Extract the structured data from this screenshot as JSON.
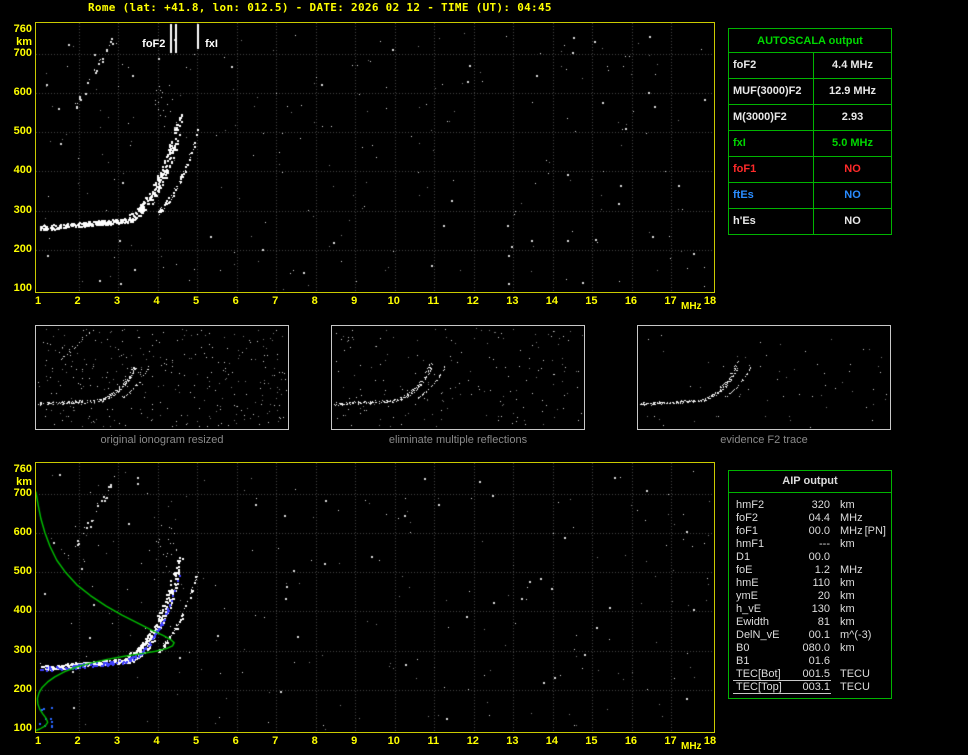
{
  "header": {
    "title": "Rome (lat: +41.8, lon: 012.5) - DATE: 2026 02 12 - TIME (UT): 04:45"
  },
  "colors": {
    "accent_yellow": "#ffff00",
    "plot_border": "#caca00",
    "grid": "#454545",
    "table_green": "#00b400",
    "title_green": "#00d800",
    "profile_green": "#00c000",
    "trace_blue": "#3f3fff",
    "no_red": "#ff2a2a",
    "no_blue": "#2a8cff",
    "text_light": "#e8e8e8",
    "caption_gray": "#8a8a8a"
  },
  "axes": {
    "x_ticks": [
      1,
      2,
      3,
      4,
      5,
      6,
      7,
      8,
      9,
      10,
      11,
      12,
      13,
      14,
      15,
      16,
      17,
      18
    ],
    "x_unit": "MHz",
    "y_ticks": [
      760,
      700,
      600,
      500,
      400,
      300,
      200,
      100
    ],
    "y_unit": "km"
  },
  "top_plot": {
    "markers": [
      {
        "label": "foF2",
        "freq": 4.4
      },
      {
        "label": "fxI",
        "freq": 5.0
      }
    ]
  },
  "autoscala": {
    "title": "AUTOSCALA output",
    "rows": [
      {
        "param": "foF2",
        "value": "4.4 MHz",
        "color": "#e8e8e8"
      },
      {
        "param": "MUF(3000)F2",
        "value": "12.9 MHz",
        "color": "#e8e8e8"
      },
      {
        "param": "M(3000)F2",
        "value": "2.93",
        "color": "#e8e8e8"
      },
      {
        "param": "fxI",
        "value": "5.0 MHz",
        "color": "#00d800"
      },
      {
        "param": "foF1",
        "value": "NO",
        "color": "#ff2a2a"
      },
      {
        "param": "ftEs",
        "value": "NO",
        "color": "#2a8cff"
      },
      {
        "param": "h'Es",
        "value": "NO",
        "color": "#e8e8e8"
      }
    ]
  },
  "thumbnails": [
    {
      "caption": "original ionogram resized"
    },
    {
      "caption": "eliminate multiple reflections"
    },
    {
      "caption": "evidence F2 trace"
    }
  ],
  "aip": {
    "title": "AIP output",
    "rows": [
      {
        "param": "hmF2",
        "value": "320",
        "unit": "km"
      },
      {
        "param": "foF2",
        "value": "04.4",
        "unit": "MHz"
      },
      {
        "param": "foF1",
        "value": "00.0",
        "unit": "MHz",
        "extra": "[PN]"
      },
      {
        "param": "hmF1",
        "value": "---",
        "unit": "km"
      },
      {
        "param": "D1",
        "value": "00.0",
        "unit": ""
      },
      {
        "param": "foE",
        "value": "1.2",
        "unit": "MHz"
      },
      {
        "param": "hmE",
        "value": "110",
        "unit": "km"
      },
      {
        "param": "ymE",
        "value": "20",
        "unit": "km"
      },
      {
        "param": "h_vE",
        "value": "130",
        "unit": "km"
      },
      {
        "param": "Ewidth",
        "value": "81",
        "unit": "km"
      },
      {
        "param": "DelN_vE",
        "value": "00.1",
        "unit": "m^(-3)"
      },
      {
        "param": "B0",
        "value": "080.0",
        "unit": "km"
      },
      {
        "param": "B1",
        "value": "01.6",
        "unit": ""
      },
      {
        "param": "TEC[Bot]",
        "value": "001.5",
        "unit": "TECU",
        "underline": true
      },
      {
        "param": "TEC[Top]",
        "value": "003.1",
        "unit": "TECU",
        "underline": true
      }
    ]
  },
  "chart_data": {
    "type": "scatter",
    "title": "Vertical-incidence ionogram, Rome, 2026-02-12 04:45 UT",
    "xlabel": "MHz",
    "ylabel": "km",
    "xlim": [
      1,
      18
    ],
    "ylim": [
      100,
      760
    ],
    "grid": true,
    "scaled_values": {
      "foF2_MHz": 4.4,
      "MUF3000F2_MHz": 12.9,
      "M3000F2": 2.93,
      "fxI_MHz": 5.0,
      "foF1": "NO",
      "ftEs": "NO",
      "hpEs": "NO"
    },
    "f2_trace_model": {
      "h_base": 256,
      "h_slope": 9,
      "f_knee": 2.9,
      "f_end": 4.62,
      "h_rise": 235,
      "exp": 2.6,
      "f_min": 1.0,
      "f_max": 4.6
    },
    "x_mode_offset_MHz": 0.45,
    "electron_density_profile_fh": [
      [
        0.92,
        705
      ],
      [
        0.98,
        670
      ],
      [
        1.05,
        635
      ],
      [
        1.15,
        600
      ],
      [
        1.28,
        565
      ],
      [
        1.45,
        530
      ],
      [
        1.68,
        498
      ],
      [
        1.95,
        468
      ],
      [
        2.3,
        440
      ],
      [
        2.7,
        413
      ],
      [
        3.1,
        390
      ],
      [
        3.5,
        370
      ],
      [
        3.85,
        352
      ],
      [
        4.15,
        338
      ],
      [
        4.33,
        328
      ],
      [
        4.42,
        320
      ],
      [
        4.38,
        312
      ],
      [
        4.22,
        305
      ],
      [
        3.95,
        298
      ],
      [
        3.6,
        292
      ],
      [
        3.2,
        286
      ],
      [
        2.75,
        278
      ],
      [
        2.3,
        268
      ],
      [
        1.95,
        258
      ],
      [
        1.65,
        246
      ],
      [
        1.4,
        233
      ],
      [
        1.22,
        220
      ],
      [
        1.08,
        206
      ],
      [
        1.0,
        192
      ],
      [
        0.96,
        178
      ],
      [
        0.97,
        164
      ],
      [
        1.02,
        150
      ],
      [
        1.1,
        138
      ],
      [
        1.18,
        127
      ],
      [
        1.22,
        117
      ],
      [
        1.16,
        108
      ],
      [
        1.02,
        100
      ],
      [
        0.88,
        94
      ]
    ],
    "aip_parameters": {
      "hmF2_km": 320,
      "foF2_MHz": 4.4,
      "foF1_MHz": 0.0,
      "hmF1_km": null,
      "D1": 0.0,
      "foE_MHz": 1.2,
      "hmE_km": 110,
      "ymE_km": 20,
      "h_vE_km": 130,
      "Ewidth_km": 81,
      "DelN_vE_m3": 0.1,
      "B0_km": 80.0,
      "B1": 1.6,
      "TEC_bot_TECU": 1.5,
      "TEC_top_TECU": 3.1
    },
    "render": {
      "seed": 20260212,
      "top_noise": 250,
      "bottom_noise": 230,
      "thumb_noise": [
        330,
        190,
        60
      ]
    }
  }
}
